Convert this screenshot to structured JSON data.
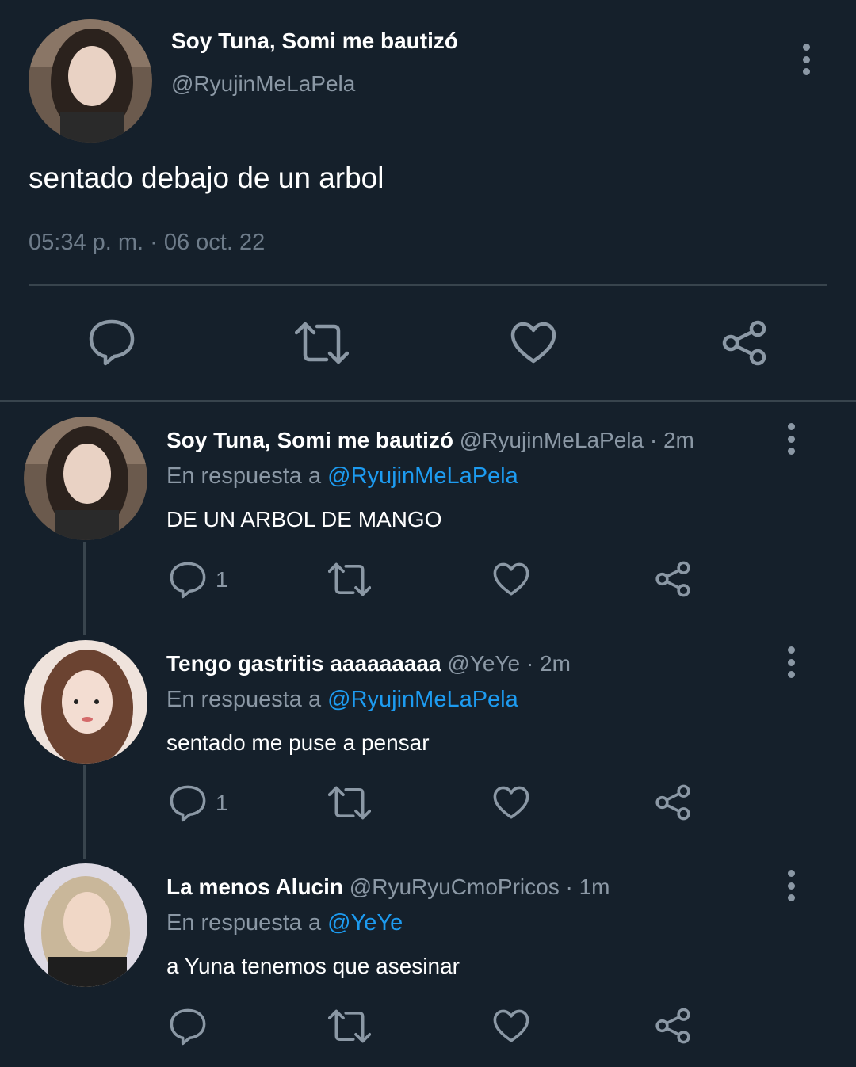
{
  "main_tweet": {
    "author_name": "Soy Tuna, Somi me bautizó",
    "author_handle": "@RyujinMeLaPela",
    "text": "sentado debajo de un arbol",
    "timestamp": "05:34 p. m. · 06 oct. 22",
    "avatar_icon": "profile-photo",
    "actions": [
      "reply-icon",
      "retweet-icon",
      "like-icon",
      "share-icon"
    ]
  },
  "replies": [
    {
      "author_name": "Soy Tuna, Somi me bautizó",
      "meta": "@RyujinMeLaPela · 2m",
      "in_reply_prefix": "En respuesta a",
      "in_reply_handle": "@RyujinMeLaPela",
      "text": "DE UN ARBOL DE MANGO",
      "reply_count": "1"
    },
    {
      "author_name": "Tengo gastritis aaaaaaaaa",
      "meta": "@YeYe · 2m",
      "in_reply_prefix": "En respuesta a",
      "in_reply_handle": "@RyujinMeLaPela",
      "text": "sentado me puse a pensar",
      "reply_count": "1"
    },
    {
      "author_name": "La menos Alucin",
      "meta": "@RyuRyuCmoPricos · 1m",
      "in_reply_prefix": "En respuesta a",
      "in_reply_handle": "@YeYe",
      "text": "a Yuna tenemos que asesinar",
      "reply_count": ""
    }
  ],
  "colors": {
    "background": "#15202b",
    "text": "#ffffff",
    "secondary": "#8b98a5",
    "link": "#1d9bf0",
    "divider": "#38444d"
  }
}
